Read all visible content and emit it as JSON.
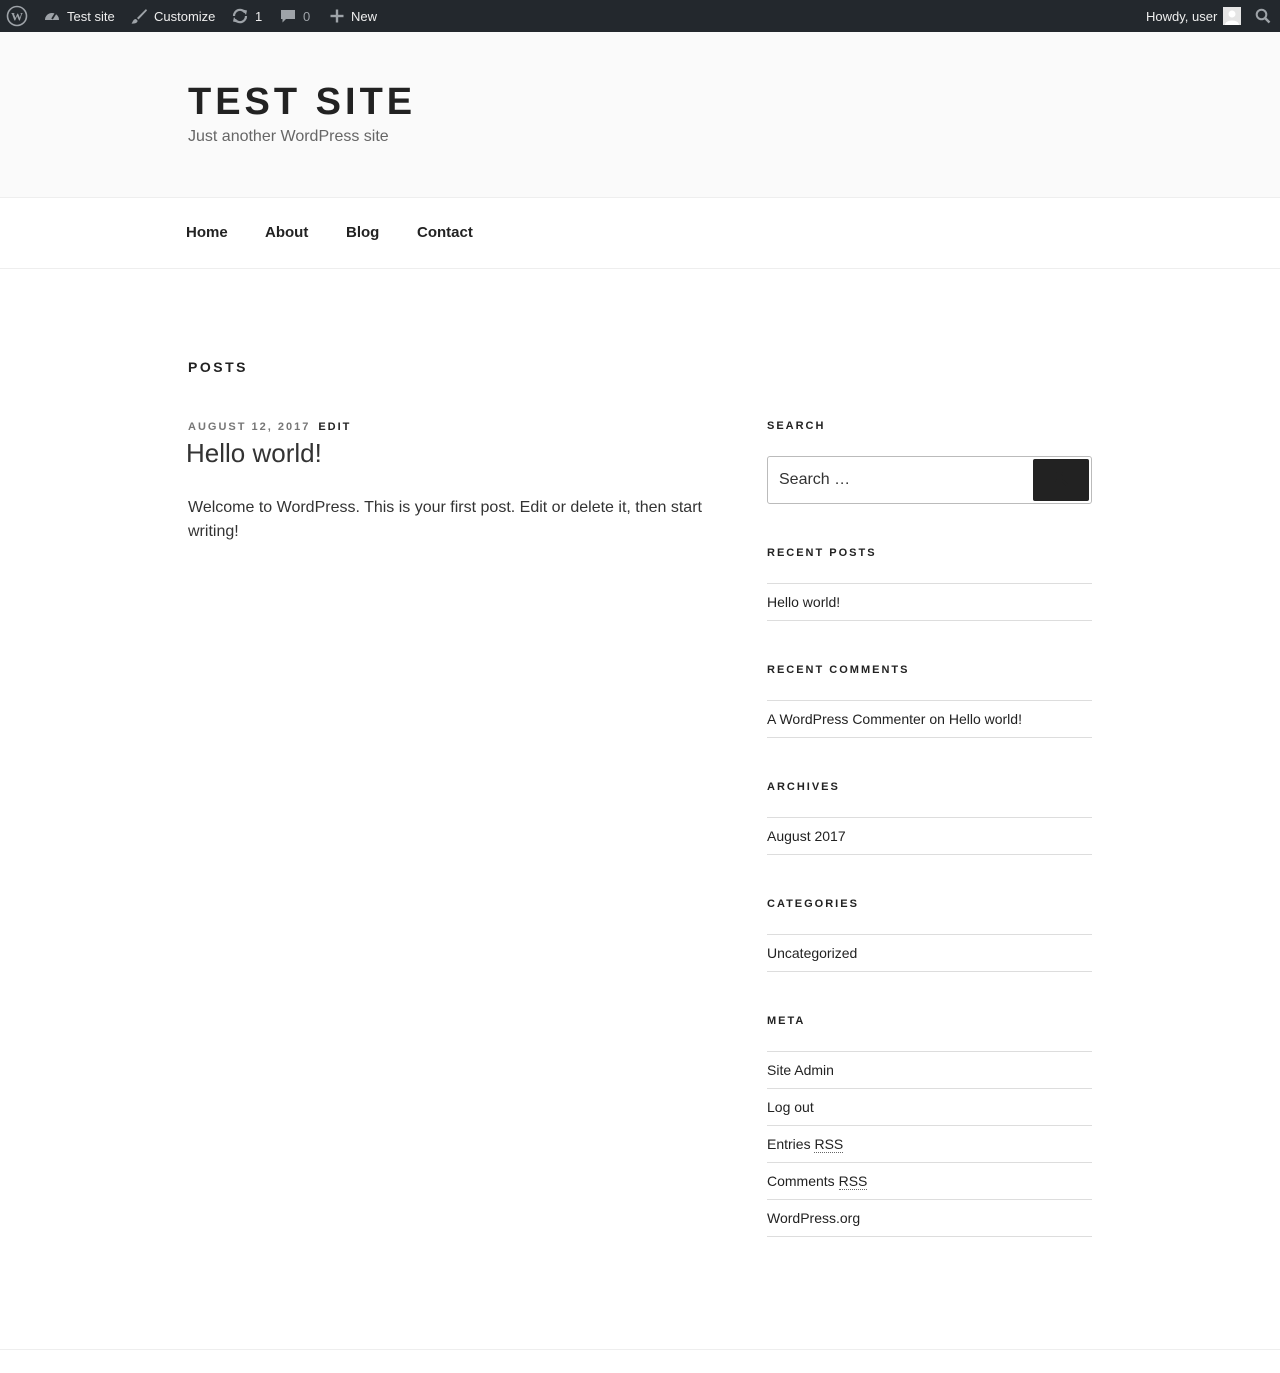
{
  "adminbar": {
    "site_name": "Test site",
    "customize_label": "Customize",
    "updates_count": "1",
    "comments_count": "0",
    "new_label": "New",
    "howdy": "Howdy, user"
  },
  "header": {
    "title": "TEST SITE",
    "description": "Just another WordPress site"
  },
  "nav": {
    "items": [
      "Home",
      "About",
      "Blog",
      "Contact"
    ]
  },
  "main": {
    "page_label": "POSTS",
    "post": {
      "date": "AUGUST 12, 2017",
      "edit_label": "EDIT",
      "title": "Hello world!",
      "body": "Welcome to WordPress. This is your first post. Edit or delete it, then start writing!"
    }
  },
  "sidebar": {
    "search": {
      "title": "SEARCH",
      "placeholder": "Search …"
    },
    "recent_posts": {
      "title": "RECENT POSTS",
      "items": [
        "Hello world!"
      ]
    },
    "recent_comments": {
      "title": "RECENT COMMENTS",
      "author": "A WordPress Commenter",
      "on": "on",
      "post": "Hello world!"
    },
    "archives": {
      "title": "ARCHIVES",
      "items": [
        "August 2017"
      ]
    },
    "categories": {
      "title": "CATEGORIES",
      "items": [
        "Uncategorized"
      ]
    },
    "meta": {
      "title": "META",
      "site_admin": "Site Admin",
      "log_out": "Log out",
      "entries_prefix": "Entries",
      "comments_prefix": "Comments",
      "rss": "RSS",
      "wordpress_org": "WordPress.org"
    }
  }
}
